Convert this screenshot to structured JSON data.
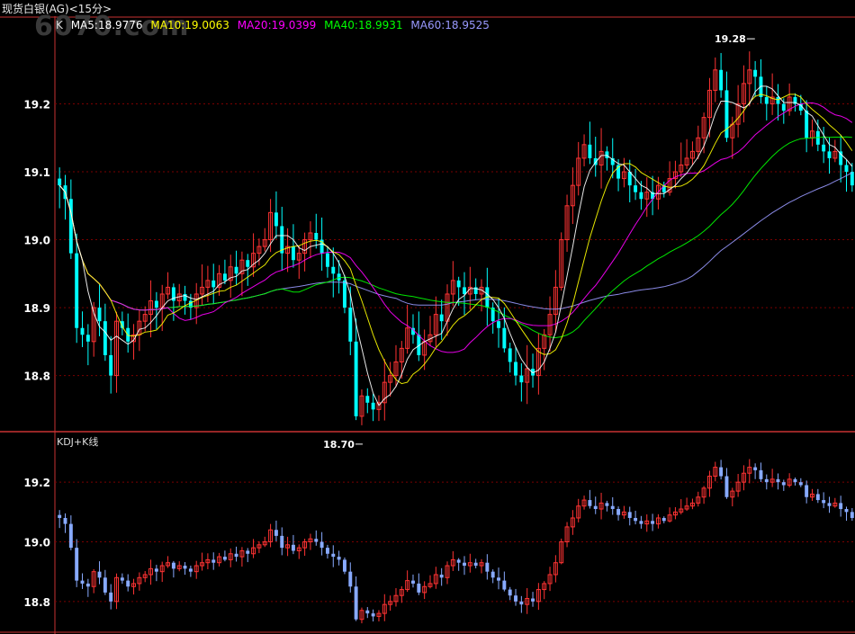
{
  "window": {
    "title": "现货白银(AG)<15分>",
    "watermark": "6070.com"
  },
  "legend": {
    "k_label": "K",
    "items": [
      {
        "label": "MA5:18.9776",
        "color": "#ffffff"
      },
      {
        "label": "MA10:19.0063",
        "color": "#ffff00"
      },
      {
        "label": "MA20:19.0399",
        "color": "#ff00ff"
      },
      {
        "label": "MA40:18.9931",
        "color": "#00ff00"
      },
      {
        "label": "MA60:18.9525",
        "color": "#9999ff"
      }
    ]
  },
  "annotations": {
    "high": "19.28",
    "low": "18.70"
  },
  "sub_panel": {
    "title": "KDJ+K线"
  },
  "colors": {
    "up": "#ff3333",
    "down": "#00ffff",
    "sub_up": "#ff3333",
    "sub_down": "#88aaff",
    "grid": "#7a0000",
    "axis": "#c83232",
    "label": "#ffffff"
  },
  "chart_data": {
    "type": "candlestick",
    "main": {
      "ylim": [
        18.72,
        19.3
      ],
      "y_ticks": [
        18.8,
        18.9,
        19.0,
        19.1,
        19.2
      ],
      "tick_labels": [
        "18.8",
        "18.9",
        "19.0",
        "19.1",
        "19.2"
      ]
    },
    "sub": {
      "ylim": [
        18.7,
        19.3
      ],
      "y_ticks": [
        18.8,
        19.0,
        19.2
      ],
      "tick_labels": [
        "18.8",
        "19.0",
        "19.2"
      ]
    },
    "closes": [
      19.08,
      19.06,
      18.98,
      18.87,
      18.86,
      18.85,
      18.9,
      18.88,
      18.83,
      18.8,
      18.88,
      18.87,
      18.85,
      18.86,
      18.88,
      18.89,
      18.91,
      18.9,
      18.92,
      18.93,
      18.91,
      18.92,
      18.91,
      18.9,
      18.92,
      18.93,
      18.94,
      18.93,
      18.95,
      18.94,
      18.96,
      18.95,
      18.97,
      18.96,
      18.98,
      18.99,
      19.0,
      19.04,
      19.02,
      18.98,
      18.99,
      18.97,
      18.98,
      19.0,
      19.01,
      19.0,
      18.98,
      18.96,
      18.95,
      18.94,
      18.9,
      18.85,
      18.74,
      18.77,
      18.76,
      18.75,
      18.76,
      18.79,
      18.8,
      18.82,
      18.84,
      18.87,
      18.86,
      18.83,
      18.85,
      18.86,
      18.89,
      18.88,
      18.92,
      18.94,
      18.93,
      18.92,
      18.93,
      18.92,
      18.93,
      18.9,
      18.88,
      18.87,
      18.84,
      18.82,
      18.8,
      18.79,
      18.81,
      18.8,
      18.84,
      18.86,
      18.89,
      18.93,
      19.0,
      19.05,
      19.08,
      19.12,
      19.14,
      19.12,
      19.11,
      19.13,
      19.12,
      19.11,
      19.09,
      19.1,
      19.08,
      19.07,
      19.06,
      19.07,
      19.06,
      19.08,
      19.07,
      19.09,
      19.1,
      19.11,
      19.12,
      19.13,
      19.15,
      19.18,
      19.22,
      19.25,
      19.22,
      19.15,
      19.17,
      19.2,
      19.23,
      19.25,
      19.24,
      19.21,
      19.2,
      19.21,
      19.2,
      19.19,
      19.21,
      19.2,
      19.19,
      19.15,
      19.16,
      19.14,
      19.13,
      19.12,
      19.13,
      19.11,
      19.1,
      19.08
    ]
  }
}
